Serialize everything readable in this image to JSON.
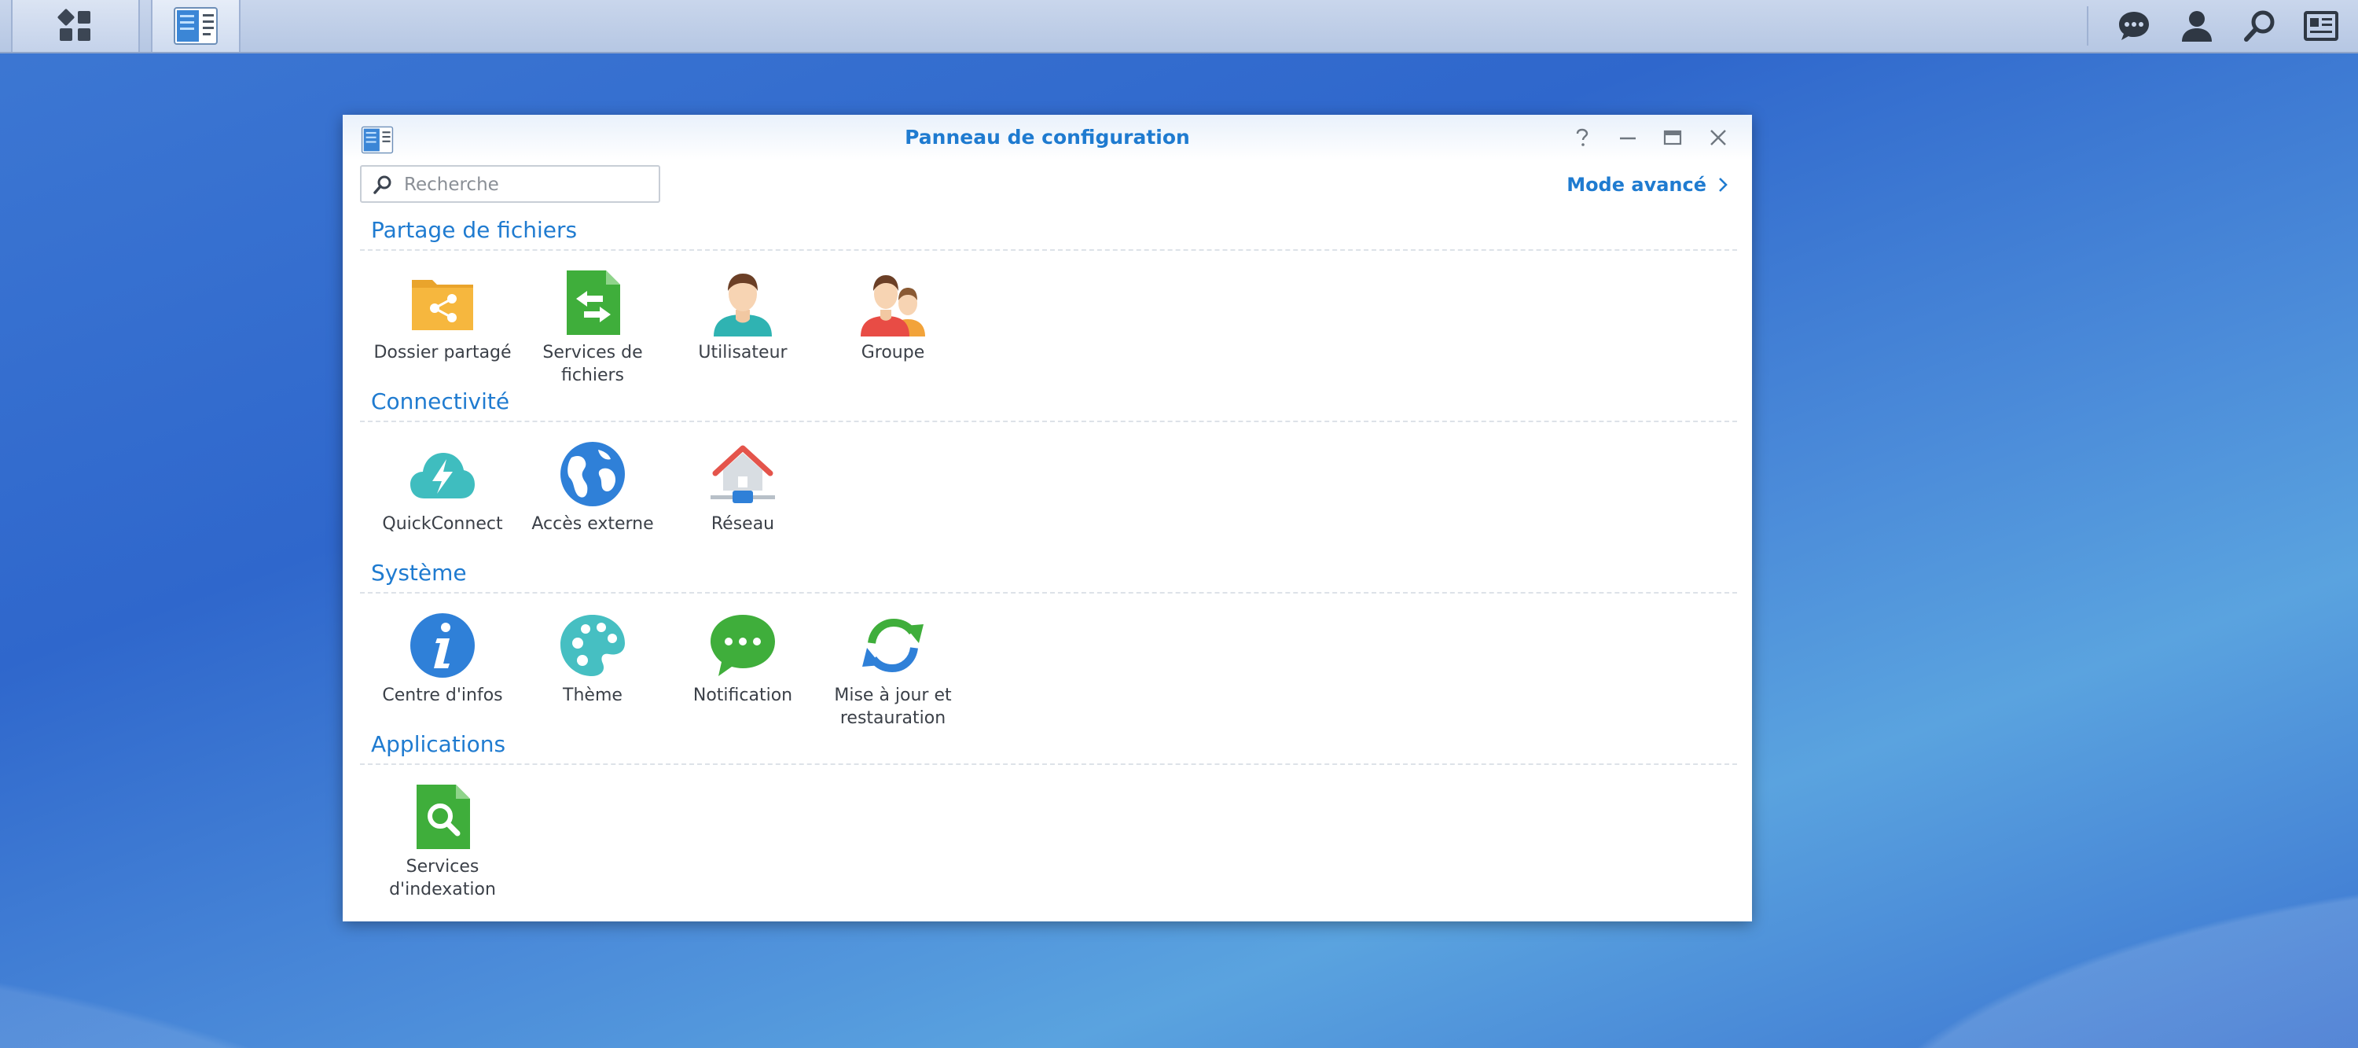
{
  "window": {
    "title": "Panneau de configuration",
    "search_placeholder": "Recherche",
    "advanced_mode": "Mode avancé"
  },
  "taskbar": {
    "left_icons": [
      "main-menu-icon",
      "control-panel-icon"
    ],
    "right_icons": [
      "chat-icon",
      "user-icon",
      "search-icon",
      "widgets-icon"
    ]
  },
  "sections": [
    {
      "title": "Partage de fichiers",
      "items": [
        {
          "label": "Dossier partagé",
          "icon": "shared-folder-icon"
        },
        {
          "label": "Services de fichiers",
          "icon": "file-services-icon"
        },
        {
          "label": "Utilisateur",
          "icon": "user-icon"
        },
        {
          "label": "Groupe",
          "icon": "group-icon"
        }
      ]
    },
    {
      "title": "Connectivité",
      "items": [
        {
          "label": "QuickConnect",
          "icon": "quickconnect-icon"
        },
        {
          "label": "Accès externe",
          "icon": "globe-icon"
        },
        {
          "label": "Réseau",
          "icon": "network-icon"
        }
      ]
    },
    {
      "title": "Système",
      "items": [
        {
          "label": "Centre d'infos",
          "icon": "info-icon"
        },
        {
          "label": "Thème",
          "icon": "palette-icon"
        },
        {
          "label": "Notification",
          "icon": "notification-icon"
        },
        {
          "label": "Mise à jour et restauration",
          "icon": "update-restore-icon"
        }
      ]
    },
    {
      "title": "Applications",
      "items": [
        {
          "label": "Services d'indexation",
          "icon": "indexing-icon"
        }
      ]
    }
  ],
  "colors": {
    "accent": "#1f7bd0",
    "folder": "#f4b43c",
    "green": "#4caf50",
    "teal": "#4cc3c9",
    "blue": "#2f80d8",
    "red": "#e4544b"
  }
}
